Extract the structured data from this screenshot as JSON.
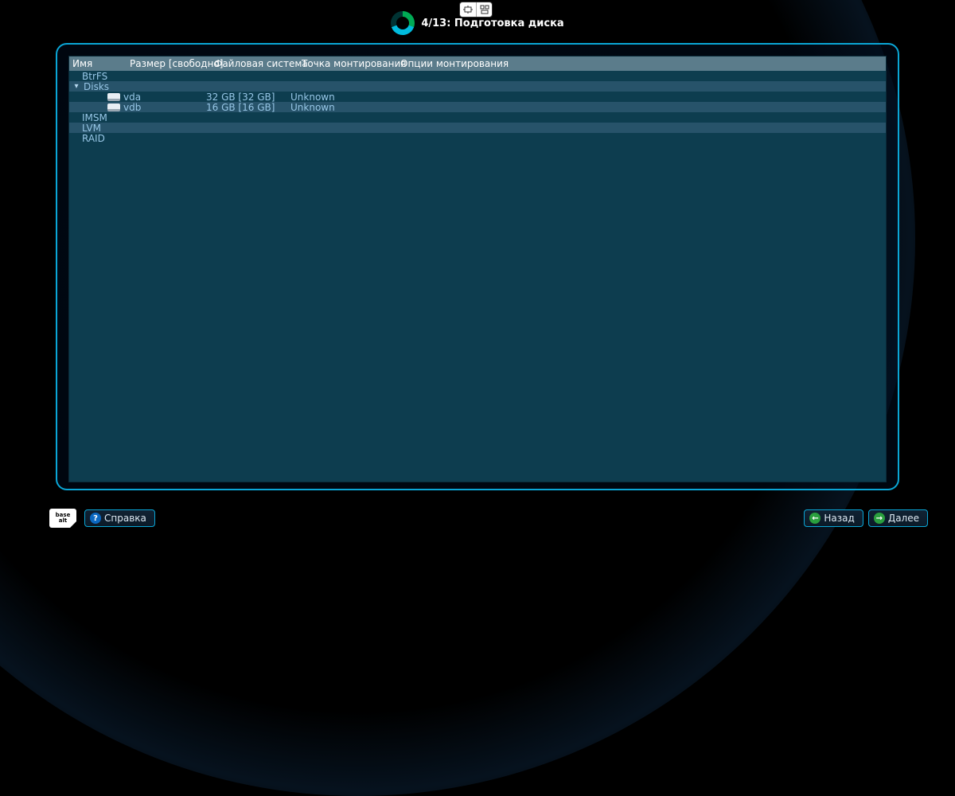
{
  "header": {
    "step_label": "4/13: Подготовка диска"
  },
  "columns": {
    "name": "Имя",
    "size": "Размер [свободно]",
    "fs": "Файловая система",
    "mount": "Точка монтирования",
    "mount_opts": "Опции монтирования"
  },
  "tree": {
    "btrfs": "BtrFS",
    "disks_label": "Disks",
    "disks": [
      {
        "name": "vda",
        "size": "32 GB [32 GB]",
        "fs": "Unknown"
      },
      {
        "name": "vdb",
        "size": "16 GB [16 GB]",
        "fs": "Unknown"
      }
    ],
    "imsm": "IMSM",
    "lvm": "LVM",
    "raid": "RAID"
  },
  "brand": "base\nalt",
  "buttons": {
    "help": "Справка",
    "back": "Назад",
    "next": "Далее"
  }
}
